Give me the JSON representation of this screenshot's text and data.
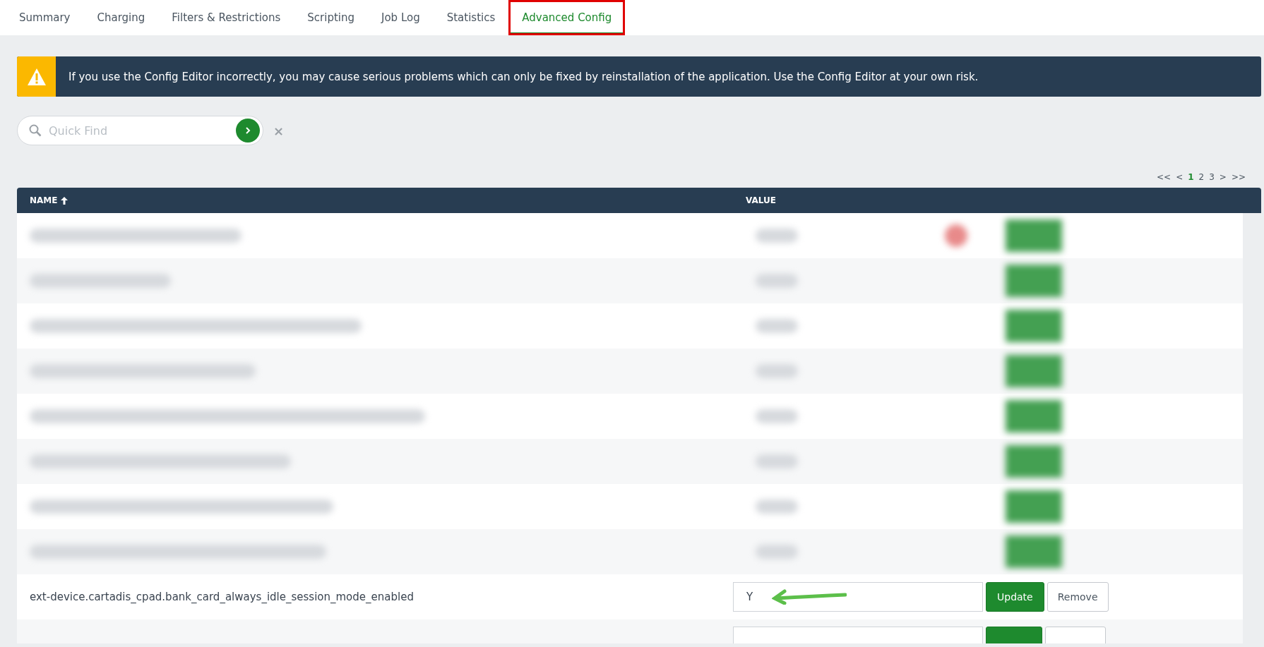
{
  "tabs": [
    {
      "label": "Summary",
      "selected": false,
      "highlighted": false
    },
    {
      "label": "Charging",
      "selected": false,
      "highlighted": false
    },
    {
      "label": "Filters & Restrictions",
      "selected": false,
      "highlighted": false
    },
    {
      "label": "Scripting",
      "selected": false,
      "highlighted": false
    },
    {
      "label": "Job Log",
      "selected": false,
      "highlighted": false
    },
    {
      "label": "Statistics",
      "selected": false,
      "highlighted": false
    },
    {
      "label": "Advanced Config",
      "selected": true,
      "highlighted": true
    }
  ],
  "warning": {
    "text": "If you use the Config Editor incorrectly, you may cause serious problems which can only be fixed by reinstallation of the application. Use the Config Editor at your own risk."
  },
  "search": {
    "placeholder": "Quick Find",
    "clear": "×"
  },
  "pagination": [
    {
      "label": "<<",
      "selected": false
    },
    {
      "label": "<",
      "selected": false
    },
    {
      "label": "1",
      "selected": true
    },
    {
      "label": "2",
      "selected": false
    },
    {
      "label": "3",
      "selected": false
    },
    {
      "label": ">",
      "selected": false
    },
    {
      "label": ">>",
      "selected": false
    }
  ],
  "table": {
    "columns": [
      {
        "label": "NAME",
        "sorted": true
      },
      {
        "label": "VALUE"
      }
    ],
    "rows": [
      {
        "kind": "blurred",
        "alert": true
      },
      {
        "kind": "blurred",
        "alert": false
      },
      {
        "kind": "blurred",
        "alert": false
      },
      {
        "kind": "blurred",
        "alert": false
      },
      {
        "kind": "blurred",
        "alert": false
      },
      {
        "kind": "blurred",
        "alert": false
      },
      {
        "kind": "blurred",
        "alert": false
      },
      {
        "kind": "blurred",
        "alert": false
      },
      {
        "kind": "entry",
        "name": "ext-device.cartadis_cpad.bank_card_always_idle_session_mode_enabled",
        "value": "Y",
        "update": "Update",
        "remove": "Remove",
        "annotated": true
      },
      {
        "kind": "cut"
      }
    ]
  }
}
